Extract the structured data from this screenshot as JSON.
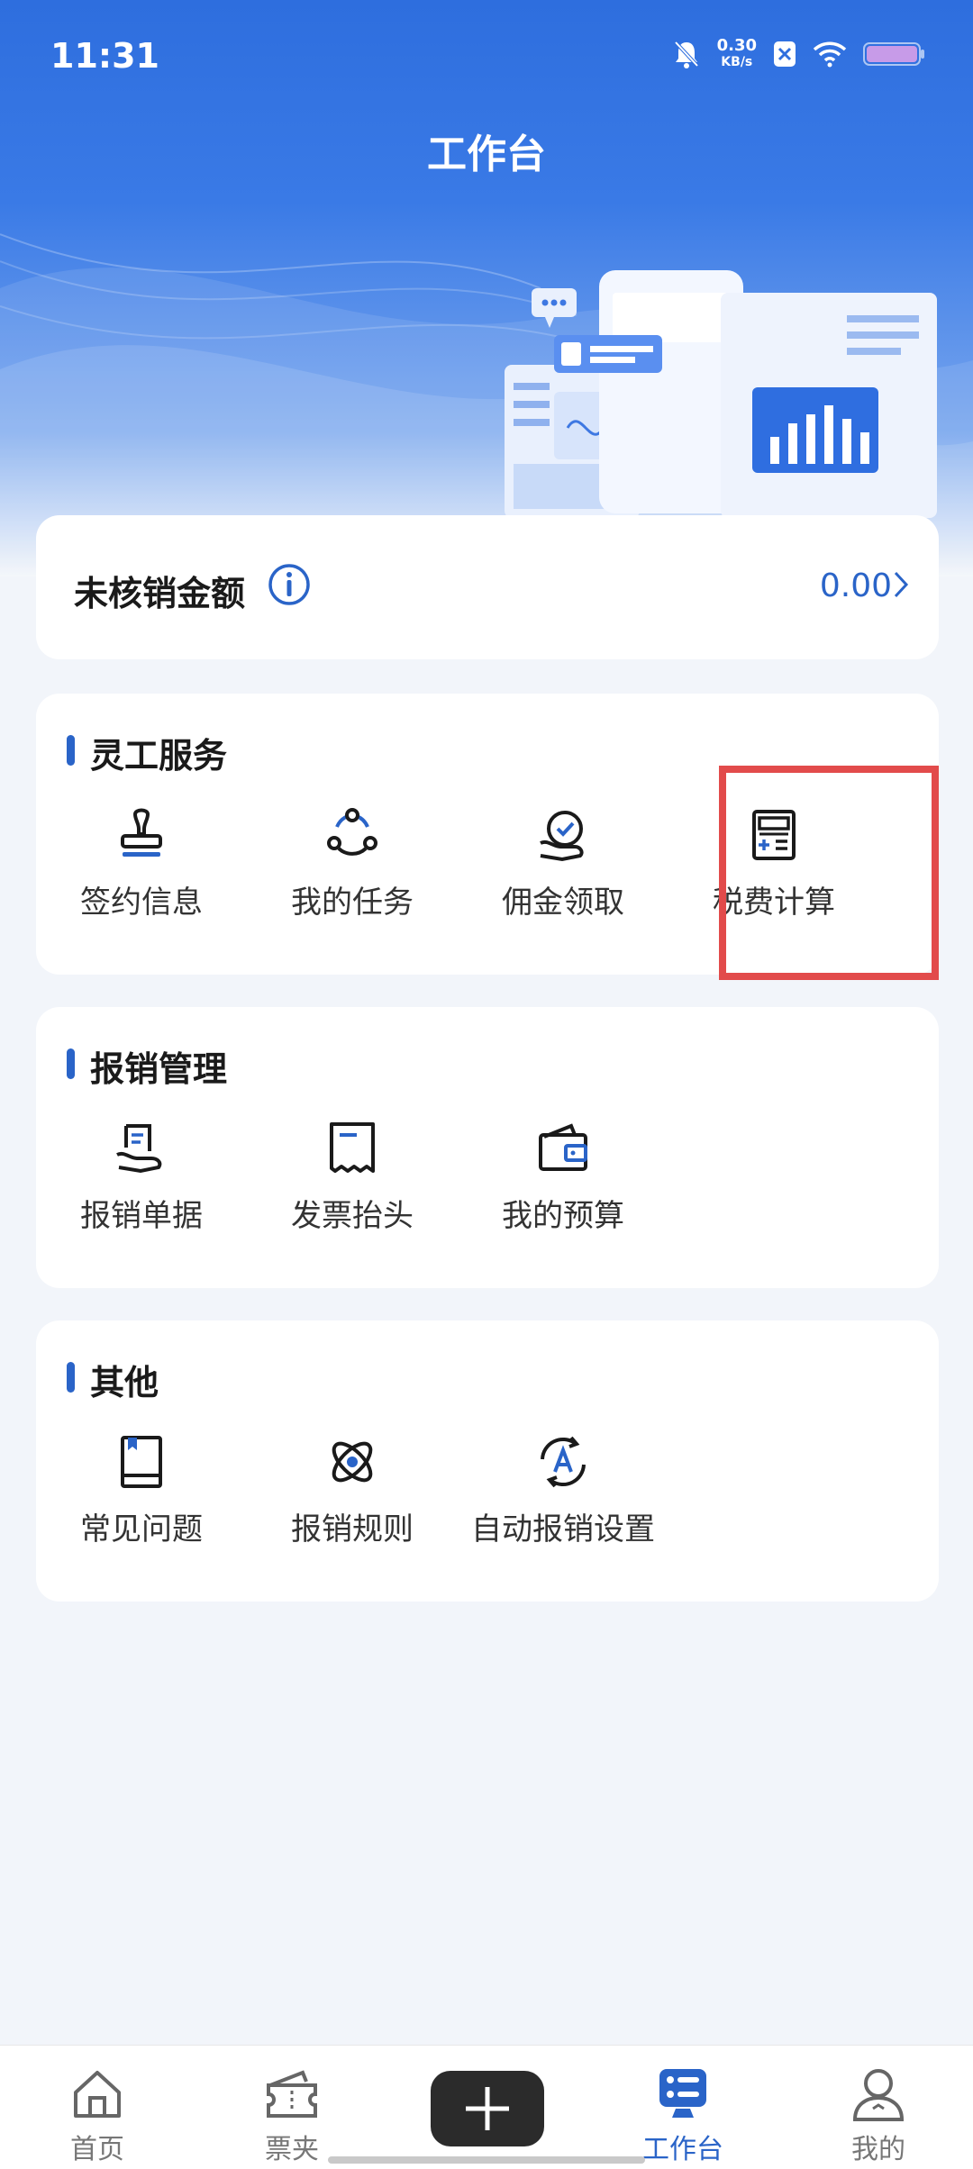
{
  "status_bar": {
    "time": "11:31",
    "net_speed_value": "0.30",
    "net_speed_unit": "KB/s"
  },
  "header": {
    "title": "工作台"
  },
  "balance": {
    "label": "未核销金额",
    "value": "0.00"
  },
  "sections": [
    {
      "title": "灵工服务",
      "items": [
        {
          "label": "签约信息",
          "icon": "stamp-icon"
        },
        {
          "label": "我的任务",
          "icon": "task-nodes-icon"
        },
        {
          "label": "佣金领取",
          "icon": "commission-icon"
        },
        {
          "label": "税费计算",
          "icon": "calculator-icon"
        }
      ]
    },
    {
      "title": "报销管理",
      "items": [
        {
          "label": "报销单据",
          "icon": "receipt-hand-icon"
        },
        {
          "label": "发票抬头",
          "icon": "invoice-icon"
        },
        {
          "label": "我的预算",
          "icon": "wallet-icon"
        }
      ]
    },
    {
      "title": "其他",
      "items": [
        {
          "label": "常见问题",
          "icon": "book-icon"
        },
        {
          "label": "报销规则",
          "icon": "atom-icon"
        },
        {
          "label": "自动报销设置",
          "icon": "auto-refresh-icon"
        }
      ]
    }
  ],
  "bottom_nav": [
    {
      "label": "首页",
      "icon": "home-icon"
    },
    {
      "label": "票夹",
      "icon": "ticket-folder-icon"
    },
    {
      "label": "",
      "icon": "plus-icon"
    },
    {
      "label": "工作台",
      "icon": "workbench-icon",
      "active": true
    },
    {
      "label": "我的",
      "icon": "profile-icon"
    }
  ],
  "colors": {
    "primary": "#2a64c8",
    "highlight": "#e24b4b",
    "header_blue": "#2e6ede"
  }
}
